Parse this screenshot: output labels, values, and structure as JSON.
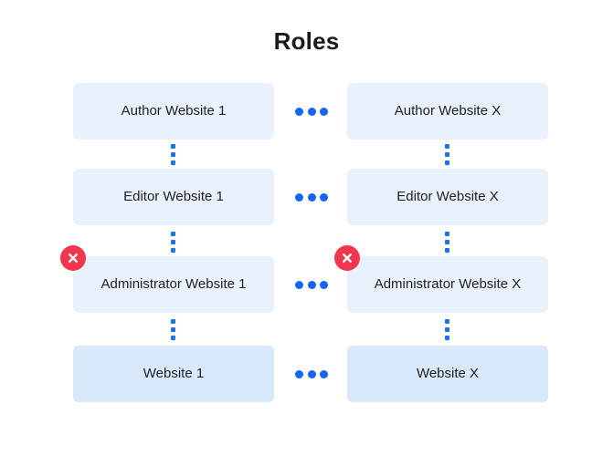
{
  "title": "Roles",
  "colors": {
    "background": "#ffffff",
    "box_fill": "#eaf1fe",
    "box_fill_strong": "#d9e8fb",
    "connector_blue": "#1565f0",
    "error_red": "#f4364c",
    "text": "#202124",
    "title_text": "#1a1a1a"
  },
  "columns": [
    {
      "id": "column-1",
      "nodes": [
        {
          "label": "Author Website 1",
          "variant": "light",
          "has_error": false
        },
        {
          "label": "Editor Website 1",
          "variant": "light",
          "has_error": false
        },
        {
          "label": "Administrator Website 1",
          "variant": "light",
          "has_error": true
        },
        {
          "label": "Website 1",
          "variant": "strong",
          "has_error": false
        }
      ]
    },
    {
      "id": "column-x",
      "nodes": [
        {
          "label": "Author Website X",
          "variant": "light",
          "has_error": false
        },
        {
          "label": "Editor Website X",
          "variant": "light",
          "has_error": false
        },
        {
          "label": "Administrator Website X",
          "variant": "light",
          "has_error": true
        },
        {
          "label": "Website X",
          "variant": "strong",
          "has_error": false
        }
      ]
    }
  ],
  "connectors": {
    "vertical_icon": "vertical-ellipsis-icon",
    "horizontal_icon": "horizontal-ellipsis-icon",
    "vertical_dot_count": 3,
    "horizontal_dot_count": 3
  },
  "badges": {
    "error_icon": "circle-x-icon",
    "error_glyph": "✕"
  }
}
